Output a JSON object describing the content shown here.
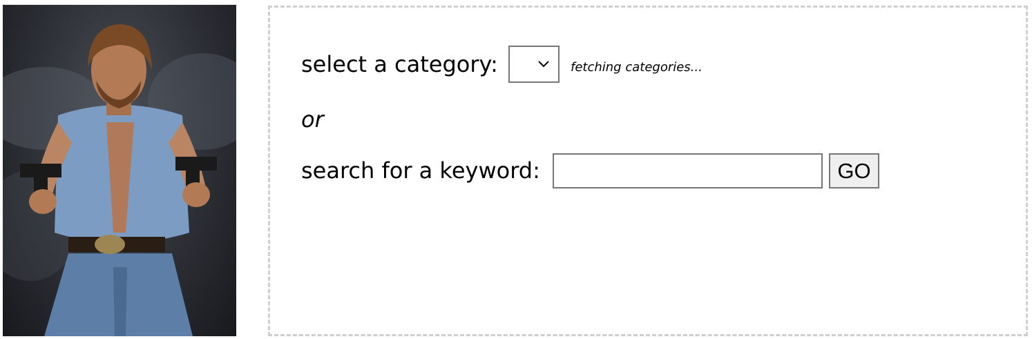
{
  "photo": {
    "alt": "photo"
  },
  "category": {
    "label": "select a category:",
    "selected_value": "",
    "status": "fetching categories..."
  },
  "divider": {
    "or_label": "or"
  },
  "search": {
    "label": "search for a keyword:",
    "value": "",
    "placeholder": "",
    "go_label": "GO"
  },
  "colors": {
    "panel_border": "#cfcfcf",
    "control_border": "#767676",
    "button_bg": "#efefef"
  }
}
